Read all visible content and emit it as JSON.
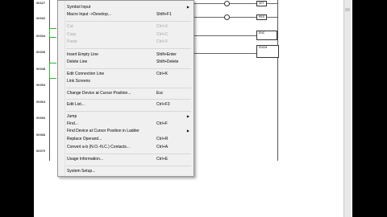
{
  "ladder": {
    "step_numbers": [
      "00327",
      "00332",
      "00334",
      "00336",
      "00348",
      "00354",
      "00364",
      "00366",
      "00368",
      "00370"
    ],
    "coils": {
      "c1": "SET",
      "c2": "RES",
      "c3": "ENC",
      "c4": "ENCM"
    }
  },
  "menu": {
    "items": [
      {
        "label": "Symbol Input",
        "shortcut": "",
        "disabled": false,
        "submenu": true
      },
      {
        "label": "Macro Input ->Develop...",
        "shortcut": "Shift+F1",
        "disabled": false,
        "submenu": false
      },
      {
        "label": "Cut",
        "shortcut": "Ctrl+X",
        "disabled": true,
        "submenu": false
      },
      {
        "label": "Copy",
        "shortcut": "Ctrl+C",
        "disabled": true,
        "submenu": false
      },
      {
        "label": "Paste",
        "shortcut": "Ctrl+V",
        "disabled": true,
        "submenu": false
      },
      {
        "label": "Insert Empty Line",
        "shortcut": "Shift+Enter",
        "disabled": false,
        "submenu": false
      },
      {
        "label": "Delete Line",
        "shortcut": "Shift+Delete",
        "disabled": false,
        "submenu": false
      },
      {
        "label": "Edit Connection Line",
        "shortcut": "Ctrl+K",
        "disabled": false,
        "submenu": false
      },
      {
        "label": "Link Screens",
        "shortcut": "",
        "disabled": false,
        "submenu": false
      },
      {
        "label": "Change Device at Cursor Position...",
        "shortcut": "Esc",
        "disabled": false,
        "submenu": false
      },
      {
        "label": "Edit List...",
        "shortcut": "Ctrl+F3",
        "disabled": false,
        "submenu": false
      },
      {
        "label": "Jump",
        "shortcut": "",
        "disabled": false,
        "submenu": true
      },
      {
        "label": "Find...",
        "shortcut": "Ctrl+F",
        "disabled": false,
        "submenu": false
      },
      {
        "label": "Find Device at Cursor Position in Ladder",
        "shortcut": "",
        "disabled": false,
        "submenu": true
      },
      {
        "label": "Replace Operand...",
        "shortcut": "Ctrl+R",
        "disabled": false,
        "submenu": false
      },
      {
        "label": "Convert a-b (N.O.-N.C.) Contacts...",
        "shortcut": "Ctrl+A",
        "disabled": false,
        "submenu": false
      },
      {
        "label": "Usage Information...",
        "shortcut": "Ctrl+E",
        "disabled": false,
        "submenu": false
      },
      {
        "label": "System Setup...",
        "shortcut": "",
        "disabled": false,
        "submenu": false
      }
    ],
    "arrow_glyph": "▶"
  }
}
